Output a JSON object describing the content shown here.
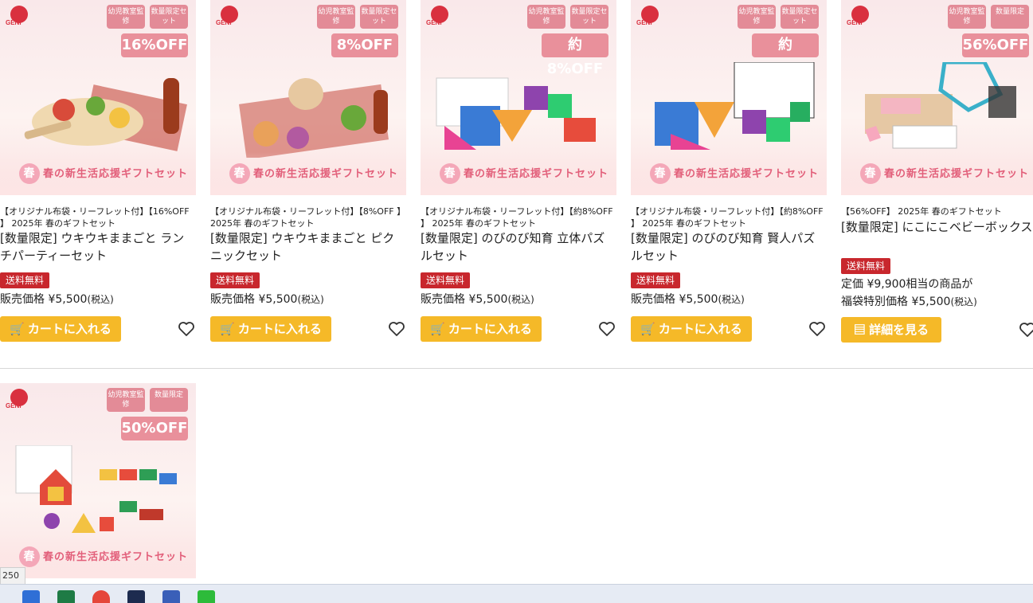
{
  "products": [
    {
      "category": "【オリジナル布袋・リーフレット付】【16%OFF 】 2025年 春のギフトセット",
      "name": "[数量限定] ウキウキままごと ランチパーティーセット",
      "shipping_badge": "送料無料",
      "price_prefix": "販売価格 ¥5,500",
      "price_tax": "(税込)",
      "button_label": "カートに入れる",
      "badge_1": "幼児教室監修",
      "badge_2": "数量限定セット",
      "image_discount": "16%OFF"
    },
    {
      "category": "【オリジナル布袋・リーフレット付】【8%OFF 】 2025年 春のギフトセット",
      "name": "[数量限定] ウキウキままごと ピクニックセット",
      "shipping_badge": "送料無料",
      "price_prefix": "販売価格 ¥5,500",
      "price_tax": "(税込)",
      "button_label": "カートに入れる",
      "badge_1": "幼児教室監修",
      "badge_2": "数量限定セット",
      "image_discount": "8%OFF"
    },
    {
      "category": "【オリジナル布袋・リーフレット付】【約8%OFF 】 2025年 春のギフトセット",
      "name": "[数量限定] のびのび知育 立体パズルセット",
      "shipping_badge": "送料無料",
      "price_prefix": "販売価格 ¥5,500",
      "price_tax": "(税込)",
      "button_label": "カートに入れる",
      "badge_1": "幼児教室監修",
      "badge_2": "数量限定セット",
      "image_discount": "約8%OFF"
    },
    {
      "category": "【オリジナル布袋・リーフレット付】【約8%OFF 】 2025年 春のギフトセット",
      "name": "[数量限定] のびのび知育 賢人パズルセット",
      "shipping_badge": "送料無料",
      "price_prefix": "販売価格 ¥5,500",
      "price_tax": "(税込)",
      "button_label": "カートに入れる",
      "badge_1": "幼児教室監修",
      "badge_2": "数量限定セット",
      "image_discount": "約8%OFF"
    },
    {
      "category": "【56%OFF】 2025年 春のギフトセット",
      "name": "[数量限定] にこにこベビーボックス",
      "shipping_badge": "送料無料",
      "list_price": "定価 ¥9,900相当の商品が",
      "price_prefix": "福袋特別価格 ¥5,500",
      "price_tax": "(税込)",
      "button_label": "詳細を見る",
      "badge_1": "幼児教室監修",
      "badge_2": "数量限定",
      "image_discount": "56%OFF"
    }
  ],
  "second_row_product": {
    "badge_1": "幼児教室監修",
    "badge_2": "数量限定",
    "image_discount": "50%OFF"
  },
  "banner_text": "春の新生活応援ギフトセット",
  "logo_text": "GENI",
  "page_counter": "250",
  "colors": {
    "cart_button": "#f5b928",
    "shipping_badge": "#c8272d",
    "image_badge": "#e38b97",
    "divider": "#d8d8d8"
  },
  "icons": [
    "cart-icon",
    "heart-icon",
    "detail-icon",
    "calendar-icon",
    "excel-icon",
    "chrome-icon",
    "line-icon"
  ]
}
